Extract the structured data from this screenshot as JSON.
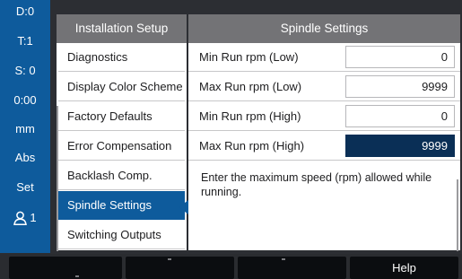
{
  "status_bar": {
    "items": [
      "D:0",
      "T:1",
      "S: 0",
      "0:00",
      "mm",
      "Abs",
      "Set"
    ],
    "user_label": "1",
    "user_icon": "user-icon"
  },
  "menu": {
    "title": "Installation Setup",
    "items": [
      "Diagnostics",
      "Display Color Scheme",
      "Factory Defaults",
      "Error Compensation",
      "Backlash Comp.",
      "Spindle Settings",
      "Switching Outputs"
    ],
    "selected": "Spindle Settings"
  },
  "settings": {
    "title": "Spindle Settings",
    "fields": [
      {
        "label": "Min Run rpm (Low)",
        "value": "0"
      },
      {
        "label": "Max Run rpm (Low)",
        "value": "9999"
      },
      {
        "label": "Min Run rpm (High)",
        "value": "0"
      },
      {
        "label": "Max Run rpm (High)",
        "value": "9999"
      }
    ],
    "active_field": "Max Run rpm (High)",
    "help_text": "Enter the maximum speed (rpm) allowed while running."
  },
  "softkeys": [
    "",
    "",
    "",
    "Help"
  ],
  "colors": {
    "accent": "#0e5b9c",
    "active_field": "#0a2f56",
    "header": "#737376",
    "background": "#2c2e33"
  }
}
